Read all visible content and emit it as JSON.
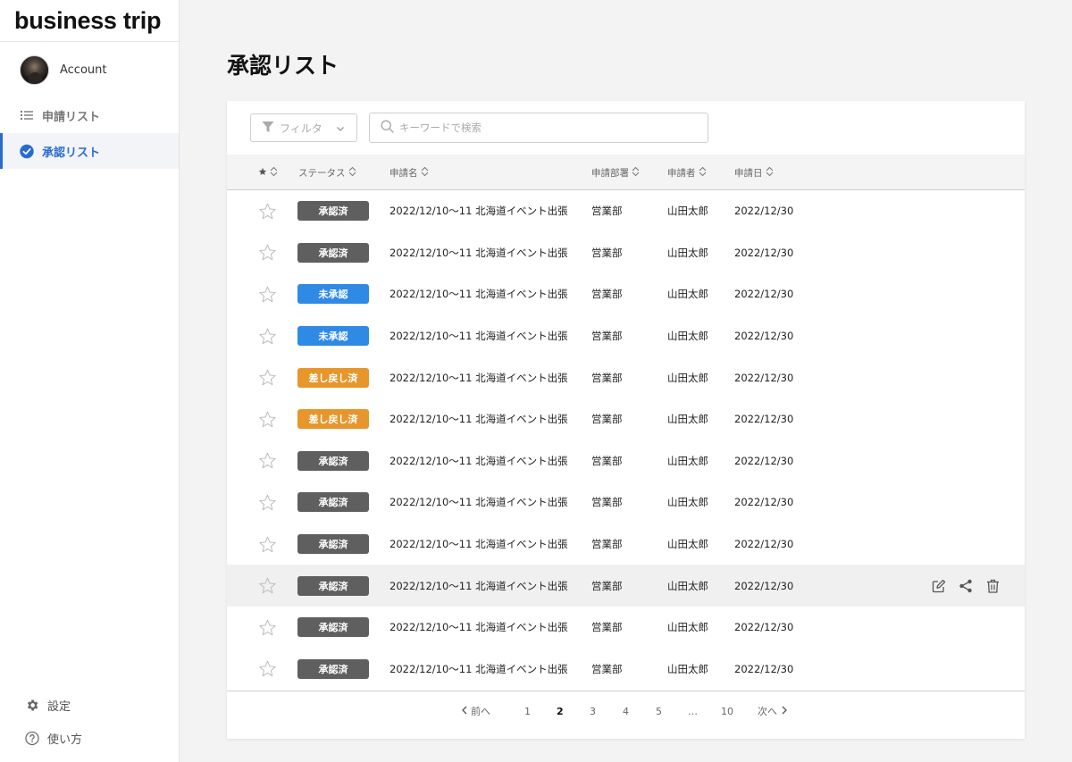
{
  "app": {
    "title": "business trip"
  },
  "account": {
    "name": "Account"
  },
  "nav": {
    "items": [
      {
        "label": "申請リスト",
        "icon": "list-icon"
      },
      {
        "label": "承認リスト",
        "icon": "check-circle-icon"
      }
    ],
    "bottom": [
      {
        "label": "設定",
        "icon": "gear-icon"
      },
      {
        "label": "使い方",
        "icon": "help-icon"
      }
    ]
  },
  "page": {
    "title": "承認リスト"
  },
  "toolbar": {
    "filter_label": "フィルタ",
    "search_placeholder": "キーワードで検索"
  },
  "table": {
    "columns": [
      "ステータス",
      "申請名",
      "申請部署",
      "申請者",
      "申請日"
    ],
    "status_colors": {
      "承認済": "#5f5f5f",
      "未承認": "#2f8ae6",
      "差し戻し済": "#e6962a"
    },
    "rows": [
      {
        "status": "承認済",
        "name": "2022/12/10〜11 北海道イベント出張",
        "dept": "営業部",
        "applicant": "山田太郎",
        "date": "2022/12/30"
      },
      {
        "status": "承認済",
        "name": "2022/12/10〜11 北海道イベント出張",
        "dept": "営業部",
        "applicant": "山田太郎",
        "date": "2022/12/30"
      },
      {
        "status": "未承認",
        "name": "2022/12/10〜11 北海道イベント出張",
        "dept": "営業部",
        "applicant": "山田太郎",
        "date": "2022/12/30"
      },
      {
        "status": "未承認",
        "name": "2022/12/10〜11 北海道イベント出張",
        "dept": "営業部",
        "applicant": "山田太郎",
        "date": "2022/12/30"
      },
      {
        "status": "差し戻し済",
        "name": "2022/12/10〜11 北海道イベント出張",
        "dept": "営業部",
        "applicant": "山田太郎",
        "date": "2022/12/30"
      },
      {
        "status": "差し戻し済",
        "name": "2022/12/10〜11 北海道イベント出張",
        "dept": "営業部",
        "applicant": "山田太郎",
        "date": "2022/12/30"
      },
      {
        "status": "承認済",
        "name": "2022/12/10〜11 北海道イベント出張",
        "dept": "営業部",
        "applicant": "山田太郎",
        "date": "2022/12/30"
      },
      {
        "status": "承認済",
        "name": "2022/12/10〜11 北海道イベント出張",
        "dept": "営業部",
        "applicant": "山田太郎",
        "date": "2022/12/30"
      },
      {
        "status": "承認済",
        "name": "2022/12/10〜11 北海道イベント出張",
        "dept": "営業部",
        "applicant": "山田太郎",
        "date": "2022/12/30"
      },
      {
        "status": "承認済",
        "name": "2022/12/10〜11 北海道イベント出張",
        "dept": "営業部",
        "applicant": "山田太郎",
        "date": "2022/12/30",
        "hover": true
      },
      {
        "status": "承認済",
        "name": "2022/12/10〜11 北海道イベント出張",
        "dept": "営業部",
        "applicant": "山田太郎",
        "date": "2022/12/30"
      },
      {
        "status": "承認済",
        "name": "2022/12/10〜11 北海道イベント出張",
        "dept": "営業部",
        "applicant": "山田太郎",
        "date": "2022/12/30"
      }
    ]
  },
  "pagination": {
    "prev_label": "前へ",
    "next_label": "次へ",
    "pages": [
      "1",
      "2",
      "3",
      "4",
      "5",
      "…",
      "10"
    ],
    "current": "2"
  }
}
